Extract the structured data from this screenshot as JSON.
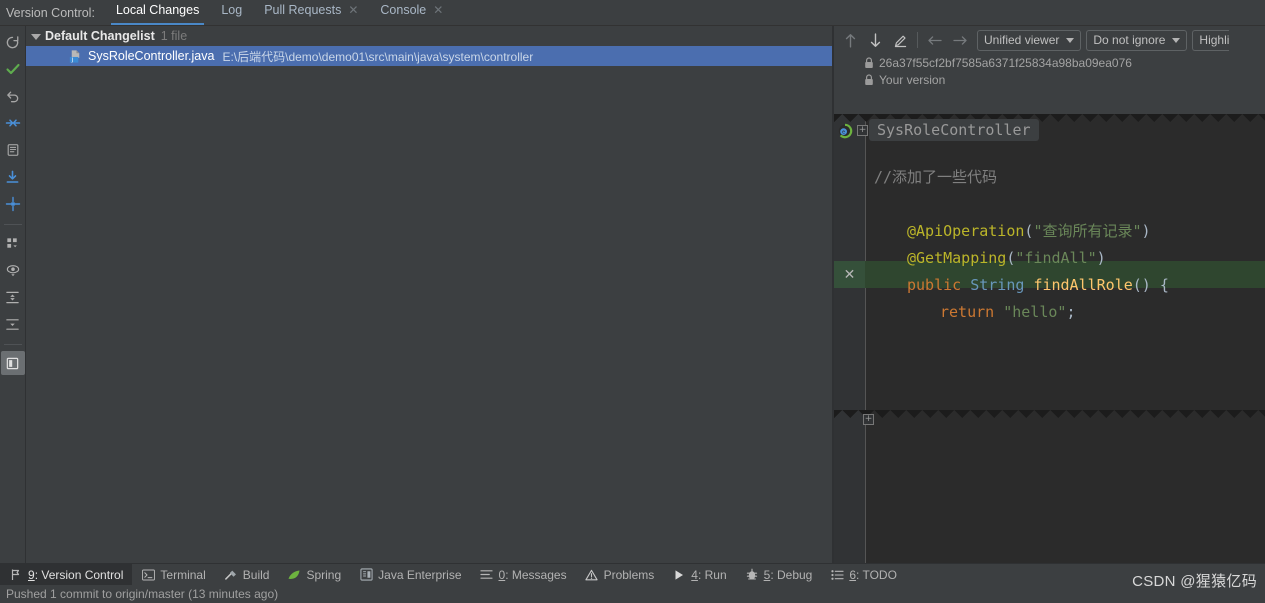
{
  "window": {
    "vc_label": "Version Control:"
  },
  "tabs": [
    {
      "label": "Local Changes",
      "active": true,
      "closable": false
    },
    {
      "label": "Log",
      "active": false,
      "closable": false
    },
    {
      "label": "Pull Requests",
      "active": false,
      "closable": true
    },
    {
      "label": "Console",
      "active": false,
      "closable": true
    }
  ],
  "left_rail": [
    {
      "name": "refresh-icon",
      "glyph": "refresh"
    },
    {
      "name": "commit-check-icon",
      "glyph": "check"
    },
    {
      "name": "rollback-icon",
      "glyph": "undo"
    },
    {
      "name": "shelve-icon",
      "glyph": "shelve"
    },
    {
      "name": "show-diff-icon",
      "glyph": "diff"
    },
    {
      "name": "update-project-icon",
      "glyph": "download"
    },
    {
      "name": "move-to-changelist-icon",
      "glyph": "move"
    },
    {
      "name": "group-by-icon",
      "glyph": "group"
    },
    {
      "name": "preview-diff-icon",
      "glyph": "eye"
    },
    {
      "name": "expand-all-icon",
      "glyph": "expand"
    },
    {
      "name": "collapse-all-icon",
      "glyph": "collapse"
    },
    {
      "name": "toggle-preview-icon",
      "glyph": "panel",
      "selected": true
    }
  ],
  "changes": {
    "changelist": {
      "name": "Default Changelist",
      "count": "1 file",
      "expanded": true
    },
    "files": [
      {
        "name": "SysRoleController.java",
        "path": "E:\\后端代码\\demo\\demo01\\src\\main\\java\\system\\controller",
        "selected": true,
        "icon": "java-class-icon"
      }
    ]
  },
  "diff": {
    "toolbar": {
      "prev_difference": "↑",
      "next_difference": "↓",
      "annotate": "✎",
      "nav_back": "←",
      "nav_forward": "→",
      "viewer_mode": "Unified viewer",
      "ignore_policy": "Do not ignore",
      "highlight_mode": "Highli"
    },
    "revision_hash": "26a37f55cf2bf7585a6371f25834a98ba09ea076",
    "your_version": "Your version",
    "fold_label": "SysRoleController",
    "code_lines": [
      {
        "indent": 0,
        "tokens": [
          {
            "t": "//添加了一些代码",
            "c": "comment"
          }
        ]
      },
      {
        "indent": 0,
        "tokens": []
      },
      {
        "indent": 1,
        "tokens": [
          {
            "t": "@ApiOperation",
            "c": "anno"
          },
          {
            "t": "(",
            "c": "paren"
          },
          {
            "t": "\"查询所有记录\"",
            "c": "str"
          },
          {
            "t": ")",
            "c": "paren"
          }
        ]
      },
      {
        "indent": 1,
        "tokens": [
          {
            "t": "@GetMapping",
            "c": "anno"
          },
          {
            "t": "(",
            "c": "paren"
          },
          {
            "t": "\"findAll\"",
            "c": "str"
          },
          {
            "t": ")",
            "c": "paren"
          }
        ]
      },
      {
        "indent": 1,
        "tokens": [
          {
            "t": "public ",
            "c": "kw"
          },
          {
            "t": "String ",
            "c": "cls"
          },
          {
            "t": "findAllRole",
            "c": "meth"
          },
          {
            "t": "() {",
            "c": "paren"
          }
        ]
      },
      {
        "indent": 2,
        "tokens": [
          {
            "t": "return ",
            "c": "kw"
          },
          {
            "t": "\"hello\"",
            "c": "str"
          },
          {
            "t": ";",
            "c": "punc"
          }
        ]
      }
    ]
  },
  "tool_windows": [
    {
      "num": "9",
      "label": "9: Version Control",
      "icon": "branch-icon",
      "active": true
    },
    {
      "num": "",
      "label": "Terminal",
      "icon": "terminal-icon",
      "active": false
    },
    {
      "num": "",
      "label": "Build",
      "icon": "hammer-icon",
      "active": false
    },
    {
      "num": "",
      "label": "Spring",
      "icon": "spring-leaf-icon",
      "active": false
    },
    {
      "num": "",
      "label": "Java Enterprise",
      "icon": "java-enterprise-icon",
      "active": false
    },
    {
      "num": "0",
      "label": "0: Messages",
      "icon": "messages-icon",
      "active": false
    },
    {
      "num": "",
      "label": "Problems",
      "icon": "warning-icon",
      "active": false
    },
    {
      "num": "4",
      "label": "4: Run",
      "icon": "run-icon",
      "active": false
    },
    {
      "num": "5",
      "label": "5: Debug",
      "icon": "debug-bug-icon",
      "active": false
    },
    {
      "num": "6",
      "label": "6: TODO",
      "icon": "todo-list-icon",
      "active": false
    }
  ],
  "status_bar": {
    "message": "Pushed 1 commit to origin/master (13 minutes ago)"
  },
  "watermark": "CSDN @猩猿亿码",
  "colors": {
    "accent_tab_underline": "#4a88c7",
    "selection_blue": "#4b6eaf",
    "added_green": "#2f462f",
    "added_gutter_green": "#35503a",
    "editor_bg": "#2b2b2b",
    "panel_bg": "#3c3f41"
  }
}
